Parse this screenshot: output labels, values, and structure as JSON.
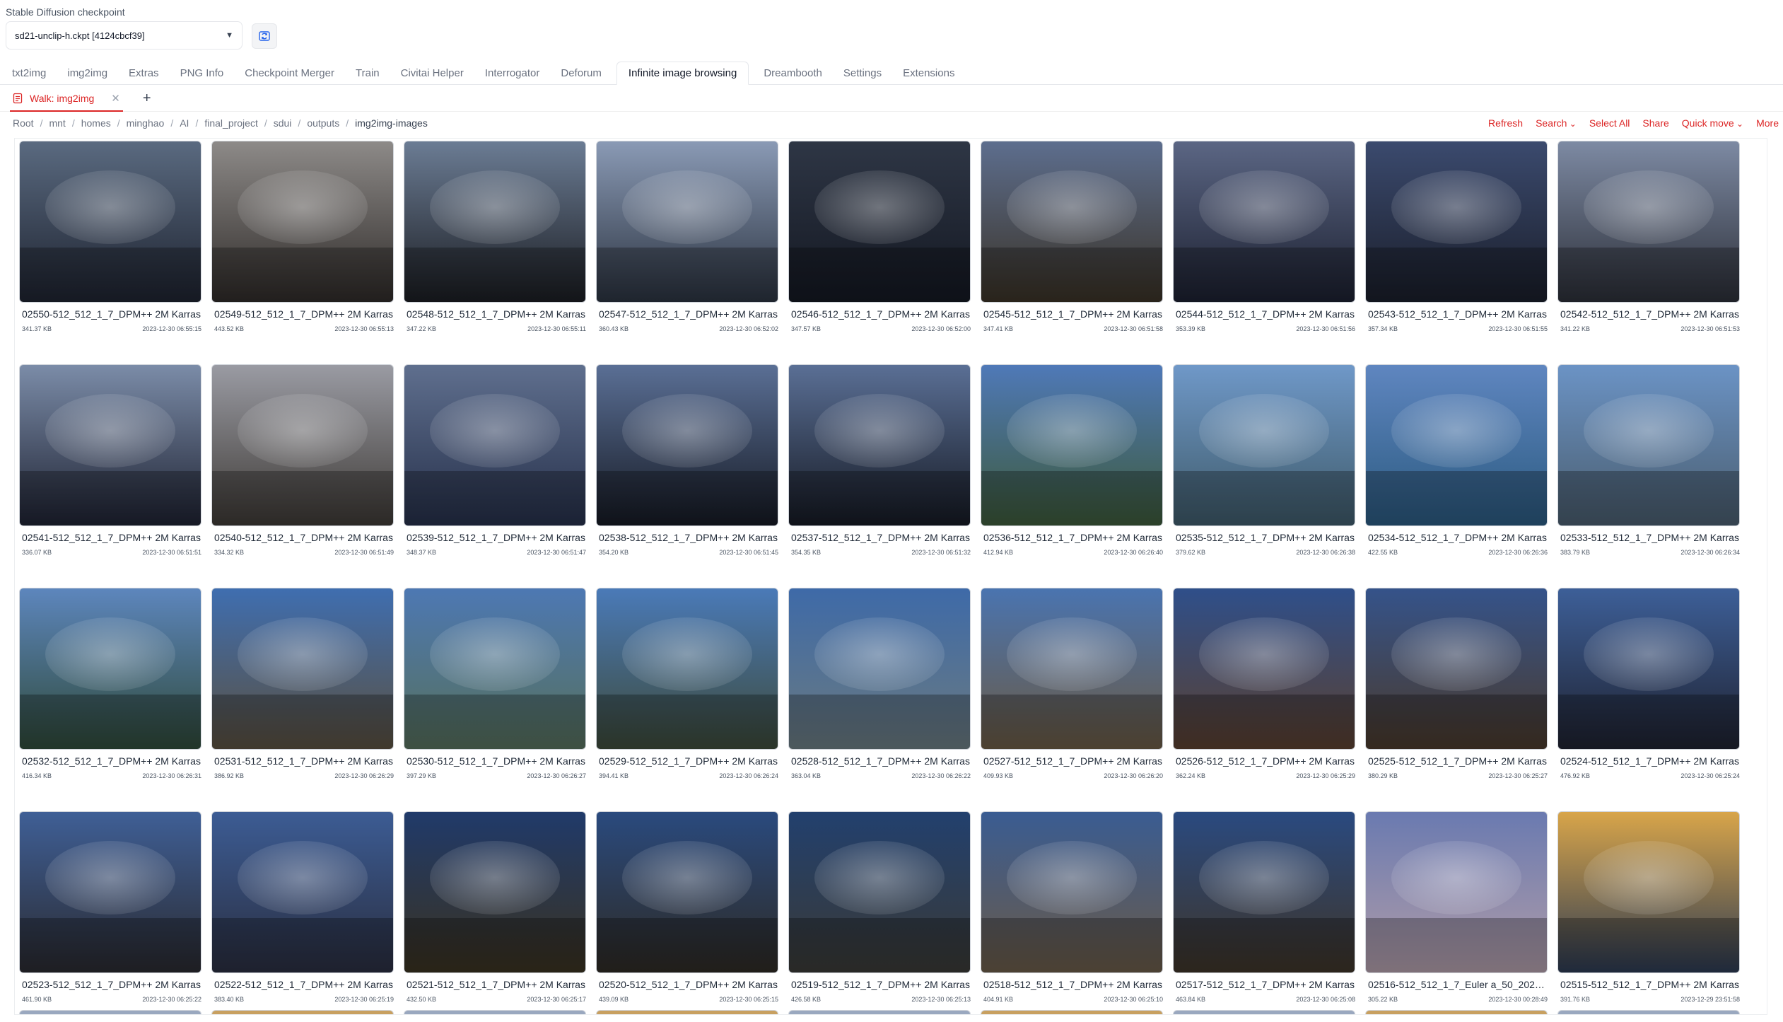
{
  "checkpoint": {
    "label": "Stable Diffusion checkpoint",
    "value": "sd21-unclip-h.ckpt [4124cbcf39]"
  },
  "main_tabs": [
    {
      "label": "txt2img"
    },
    {
      "label": "img2img"
    },
    {
      "label": "Extras"
    },
    {
      "label": "PNG Info"
    },
    {
      "label": "Checkpoint Merger"
    },
    {
      "label": "Train"
    },
    {
      "label": "Civitai Helper"
    },
    {
      "label": "Interrogator"
    },
    {
      "label": "Deforum"
    },
    {
      "label": "Infinite image browsing",
      "active": true
    },
    {
      "label": "Dreambooth"
    },
    {
      "label": "Settings"
    },
    {
      "label": "Extensions"
    }
  ],
  "sub_tab": {
    "label": "Walk: img2img"
  },
  "breadcrumb": [
    "Root",
    "mnt",
    "homes",
    "minghao",
    "AI",
    "final_project",
    "sdui",
    "outputs",
    "img2img-images"
  ],
  "actions": [
    "Refresh",
    "Search",
    "Select All",
    "Share",
    "Quick move",
    "More"
  ],
  "colors": {
    "accent": "#dc2626"
  },
  "icons": {
    "refresh": "refresh-icon",
    "folder": "folder-icon",
    "close": "close-icon",
    "add": "plus-icon",
    "dropdown": "chevron-down-icon"
  },
  "images": [
    {
      "name": "02550-512_512_1_7_DPM++ 2M Karras",
      "size": "341.37 KB",
      "date": "2023-12-30 06:55:15",
      "colors": [
        "#5a6a80",
        "#1e2330"
      ]
    },
    {
      "name": "02549-512_512_1_7_DPM++ 2M Karras",
      "size": "443.52 KB",
      "date": "2023-12-30 06:55:13",
      "colors": [
        "#8d8a88",
        "#2f2b29"
      ]
    },
    {
      "name": "02548-512_512_1_7_DPM++ 2M Karras",
      "size": "347.22 KB",
      "date": "2023-12-30 06:55:11",
      "colors": [
        "#6b7c94",
        "#1b1d22"
      ]
    },
    {
      "name": "02547-512_512_1_7_DPM++ 2M Karras",
      "size": "360.43 KB",
      "date": "2023-12-30 06:52:02",
      "colors": [
        "#8a9ab5",
        "#2b3340"
      ]
    },
    {
      "name": "02546-512_512_1_7_DPM++ 2M Karras",
      "size": "347.57 KB",
      "date": "2023-12-30 06:52:00",
      "colors": [
        "#2e3645",
        "#141822"
      ]
    },
    {
      "name": "02545-512_512_1_7_DPM++ 2M Karras",
      "size": "347.41 KB",
      "date": "2023-12-30 06:51:58",
      "colors": [
        "#5d6e8e",
        "#3a3226"
      ]
    },
    {
      "name": "02544-512_512_1_7_DPM++ 2M Karras",
      "size": "353.39 KB",
      "date": "2023-12-30 06:51:56",
      "colors": [
        "#5b6684",
        "#1c2030"
      ]
    },
    {
      "name": "02543-512_512_1_7_DPM++ 2M Karras",
      "size": "357.34 KB",
      "date": "2023-12-30 06:51:55",
      "colors": [
        "#3b4a6e",
        "#1a1e2a"
      ]
    },
    {
      "name": "02542-512_512_1_7_DPM++ 2M Karras",
      "size": "341.22 KB",
      "date": "2023-12-30 06:51:53",
      "colors": [
        "#7d8aa3",
        "#2c2f38"
      ]
    },
    {
      "name": "02541-512_512_1_7_DPM++ 2M Karras",
      "size": "336.07 KB",
      "date": "2023-12-30 06:51:51",
      "colors": [
        "#7b8ca8",
        "#1f2333"
      ]
    },
    {
      "name": "02540-512_512_1_7_DPM++ 2M Karras",
      "size": "334.32 KB",
      "date": "2023-12-30 06:51:49",
      "colors": [
        "#9a9ba3",
        "#3e3a36"
      ]
    },
    {
      "name": "02539-512_512_1_7_DPM++ 2M Karras",
      "size": "348.37 KB",
      "date": "2023-12-30 06:51:47",
      "colors": [
        "#5f6f8e",
        "#26304a"
      ]
    },
    {
      "name": "02538-512_512_1_7_DPM++ 2M Karras",
      "size": "354.20 KB",
      "date": "2023-12-30 06:51:45",
      "colors": [
        "#5a6f95",
        "#161a24"
      ]
    },
    {
      "name": "02537-512_512_1_7_DPM++ 2M Karras",
      "size": "354.35 KB",
      "date": "2023-12-30 06:51:32",
      "colors": [
        "#5a6f95",
        "#161a24"
      ]
    },
    {
      "name": "02536-512_512_1_7_DPM++ 2M Karras",
      "size": "412.94 KB",
      "date": "2023-12-30 06:26:40",
      "colors": [
        "#4f79b8",
        "#3d5a3a"
      ]
    },
    {
      "name": "02535-512_512_1_7_DPM++ 2M Karras",
      "size": "379.62 KB",
      "date": "2023-12-30 06:26:38",
      "colors": [
        "#6f98c8",
        "#3f5b6a"
      ]
    },
    {
      "name": "02534-512_512_1_7_DPM++ 2M Karras",
      "size": "422.55 KB",
      "date": "2023-12-30 06:26:36",
      "colors": [
        "#5f86c0",
        "#2b5a80"
      ]
    },
    {
      "name": "02533-512_512_1_7_DPM++ 2M Karras",
      "size": "383.79 KB",
      "date": "2023-12-30 06:26:34",
      "colors": [
        "#6b93c5",
        "#4a5d6e"
      ]
    },
    {
      "name": "02532-512_512_1_7_DPM++ 2M Karras",
      "size": "416.34 KB",
      "date": "2023-12-30 06:26:31",
      "colors": [
        "#5d86bd",
        "#2f4a3a"
      ]
    },
    {
      "name": "02531-512_512_1_7_DPM++ 2M Karras",
      "size": "386.92 KB",
      "date": "2023-12-30 06:26:29",
      "colors": [
        "#3f6eb0",
        "#5a5040"
      ]
    },
    {
      "name": "02530-512_512_1_7_DPM++ 2M Karras",
      "size": "397.29 KB",
      "date": "2023-12-30 06:26:27",
      "colors": [
        "#4d78b3",
        "#56705c"
      ]
    },
    {
      "name": "02529-512_512_1_7_DPM++ 2M Karras",
      "size": "394.41 KB",
      "date": "2023-12-30 06:26:24",
      "colors": [
        "#4a7ab8",
        "#3d4a3a"
      ]
    },
    {
      "name": "02528-512_512_1_7_DPM++ 2M Karras",
      "size": "363.04 KB",
      "date": "2023-12-30 06:26:22",
      "colors": [
        "#3e6aa8",
        "#6a7a80"
      ]
    },
    {
      "name": "02527-512_512_1_7_DPM++ 2M Karras",
      "size": "409.93 KB",
      "date": "2023-12-30 06:26:20",
      "colors": [
        "#4a74b0",
        "#6a5a44"
      ]
    },
    {
      "name": "02526-512_512_1_7_DPM++ 2M Karras",
      "size": "362.24 KB",
      "date": "2023-12-30 06:25:29",
      "colors": [
        "#2f4f8a",
        "#5a4030"
      ]
    },
    {
      "name": "02525-512_512_1_7_DPM++ 2M Karras",
      "size": "380.29 KB",
      "date": "2023-12-30 06:25:27",
      "colors": [
        "#35538a",
        "#4a3a2c"
      ]
    },
    {
      "name": "02524-512_512_1_7_DPM++ 2M Karras",
      "size": "476.92 KB",
      "date": "2023-12-30 06:25:24",
      "colors": [
        "#3d5f98",
        "#1f2230"
      ]
    },
    {
      "name": "02523-512_512_1_7_DPM++ 2M Karras",
      "size": "461.90 KB",
      "date": "2023-12-30 06:25:22",
      "colors": [
        "#3f5f96",
        "#2a2a30"
      ]
    },
    {
      "name": "02522-512_512_1_7_DPM++ 2M Karras",
      "size": "383.40 KB",
      "date": "2023-12-30 06:25:19",
      "colors": [
        "#3c5c94",
        "#2a2e40"
      ]
    },
    {
      "name": "02521-512_512_1_7_DPM++ 2M Karras",
      "size": "432.50 KB",
      "date": "2023-12-30 06:25:17",
      "colors": [
        "#203a6a",
        "#3a3220"
      ]
    },
    {
      "name": "02520-512_512_1_7_DPM++ 2M Karras",
      "size": "439.09 KB",
      "date": "2023-12-30 06:25:15",
      "colors": [
        "#2a4a7e",
        "#2e2a24"
      ]
    },
    {
      "name": "02519-512_512_1_7_DPM++ 2M Karras",
      "size": "426.58 KB",
      "date": "2023-12-30 06:25:13",
      "colors": [
        "#22406e",
        "#3a3a36"
      ]
    },
    {
      "name": "02518-512_512_1_7_DPM++ 2M Karras",
      "size": "404.91 KB",
      "date": "2023-12-30 06:25:10",
      "colors": [
        "#3a5c92",
        "#6a5a48"
      ]
    },
    {
      "name": "02517-512_512_1_7_DPM++ 2M Karras",
      "size": "463.84 KB",
      "date": "2023-12-30 06:25:08",
      "colors": [
        "#2a4a80",
        "#3e3428"
      ]
    },
    {
      "name": "02516-512_512_1_7_Euler a_50_202…",
      "size": "305.22 KB",
      "date": "2023-12-30 00:28:49",
      "colors": [
        "#6a7ab0",
        "#b09ca8"
      ]
    },
    {
      "name": "02515-512_512_1_7_DPM++ 2M Karras",
      "size": "391.76 KB",
      "date": "2023-12-29 23:51:58",
      "colors": [
        "#d8a54a",
        "#2c3a52"
      ]
    }
  ]
}
